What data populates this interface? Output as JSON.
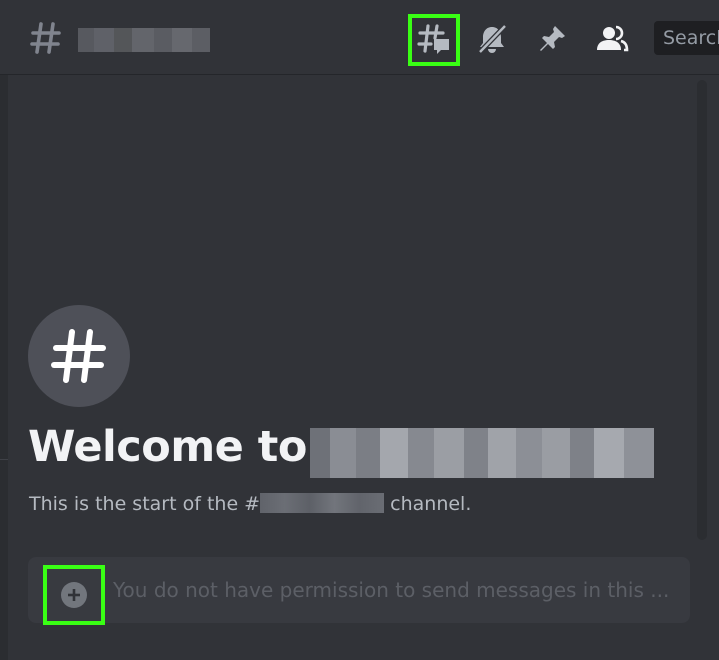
{
  "header": {
    "channel_name_redacted": true,
    "icons": [
      "threads-icon",
      "notifications-muted-icon",
      "pin-icon",
      "member-list-icon"
    ],
    "search_placeholder": "Search"
  },
  "welcome": {
    "title_prefix": "Welcome to",
    "start_prefix": "This is the start of the #",
    "start_suffix": "channel."
  },
  "composer": {
    "placeholder": "You do not have permission to send messages in this ..."
  },
  "colors": {
    "background": "#313338",
    "highlight": "#39ff14",
    "text_primary": "#f2f3f5",
    "text_muted": "#b5bac1"
  }
}
